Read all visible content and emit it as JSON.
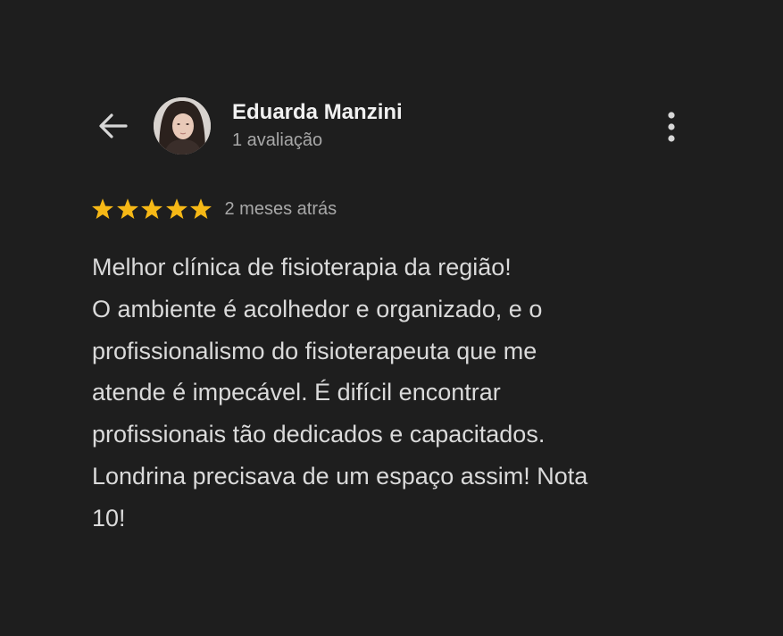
{
  "header": {
    "reviewer_name": "Eduarda Manzini",
    "review_count": "1 avaliação"
  },
  "review": {
    "rating": 5,
    "rating_max": 5,
    "date": "2 meses atrás",
    "text_lines": [
      "Melhor clínica de fisioterapia da região!",
      "O ambiente é acolhedor e organizado, e o",
      "profissionalismo do fisioterapeuta que me",
      "atende é impecável. É difícil encontrar",
      "profissionais tão dedicados e capacitados.",
      "Londrina precisava de um espaço assim! Nota",
      "10!"
    ]
  },
  "icons": {
    "back": "arrow-left-icon",
    "more": "more-vertical-icon",
    "star": "star-icon"
  },
  "colors": {
    "background": "#1e1e1e",
    "star": "#f6b816",
    "primary_text": "#f1f1f1",
    "secondary_text": "#a8a8a8",
    "body_text": "#dadada"
  }
}
